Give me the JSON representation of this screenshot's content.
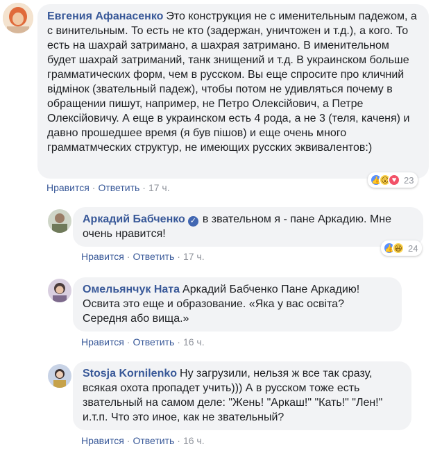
{
  "comments": [
    {
      "author": "Евгения Афанасенко",
      "text": "Это конструкция не с именительным падежом, а с винительным. То есть не кто (задержан, уничтожен и т.д.), а кого. То есть на шахрай затримано, а шахрая затримано. В именительном будет шахрай затриманий, танк знищений и т.д. В украинском больше грамматических форм, чем в русском. Вы еще спросите про кличний відмінок (звательный падеж), чтобы потом не удивляться почему в обращении пишут, например, не Петро Олексійович, а Петре Олексійовичу. А еще в украинском есть 4 рода, а не 3 (теля, каченя) и давно прошедшее время (я був пішов) и еще очень много грамматмческих структур, не имеющих русских эквивалентов:)",
      "like": "Нравится",
      "reply": "Ответить",
      "time": "17 ч.",
      "reactions": {
        "icons": [
          "like-icon",
          "wow-icon",
          "love-icon"
        ],
        "count": "23"
      }
    },
    {
      "author": "Аркадий Бабченко",
      "verified": true,
      "text": "в звательном я - пане Аркадию. Мне очень нравится!",
      "like": "Нравится",
      "reply": "Ответить",
      "time": "17 ч.",
      "reactions": {
        "icons": [
          "like-icon",
          "haha-icon"
        ],
        "count": "24"
      }
    },
    {
      "author": "Омельянчук Ната",
      "text": "Аркадий Бабченко Пане Аркадию! Освита это еще и образование. «Яка у вас освіта? Середня або вища.»",
      "like": "Нравится",
      "reply": "Ответить",
      "time": "16 ч."
    },
    {
      "author": "Stosja Kornilenko",
      "text": "Ну загрузили, нельзя ж все так сразу, всякая охота пропадет учить))) А в русском тоже есть звательный на самом деле: \"Жень! \"Аркаш!\" \"Кать!\" \"Лен!\" и.т.п. Что это иное, как не звательный?",
      "like": "Нравится",
      "reply": "Ответить",
      "time": "16 ч."
    }
  ],
  "separator": "·",
  "colors": {
    "link": "#385898",
    "bubble": "#f2f3f5",
    "meta": "#90949c"
  }
}
